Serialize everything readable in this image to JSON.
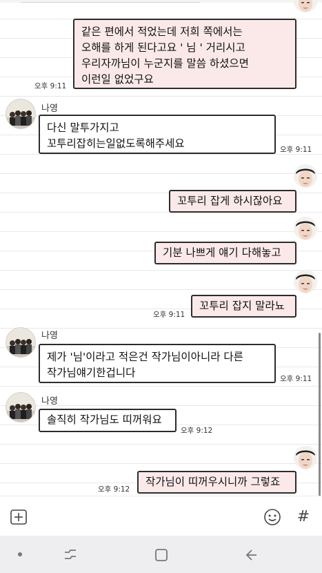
{
  "messages": [
    {
      "id": 1,
      "direction": "outgoing",
      "text": "같은 편에서 적었는데 저희 쪽에서는\n오해를 하게 된다고요 ' 님 ' 거리시고\n우리자까님이 누군지를 말씀 하셨으면\n이런일 없었구요",
      "time": "오후 9:11"
    },
    {
      "id": 2,
      "direction": "incoming",
      "sender": "나영",
      "text": "다신 말투가지고\n꼬투리잡히는일없도록해주세요",
      "time": "오후 9:11"
    },
    {
      "id": 3,
      "direction": "outgoing",
      "text": "꼬투리 잡게 하시잖아요"
    },
    {
      "id": 4,
      "direction": "outgoing",
      "text": "기분 나쁘게 얘기 다해놓고"
    },
    {
      "id": 5,
      "direction": "outgoing",
      "text": "꼬투리 잡지 말라뇨",
      "time": "오후 9:11"
    },
    {
      "id": 6,
      "direction": "incoming",
      "sender": "나영",
      "text": "제가 '님'이라고 적은건 작가님이아니라 다른\n작가님얘기한겁니다",
      "time": "오후 9:11"
    },
    {
      "id": 7,
      "direction": "incoming",
      "sender": "나영",
      "text": "솔직히 작가님도 띠꺼워요",
      "time": "오후 9:12"
    },
    {
      "id": 8,
      "direction": "outgoing",
      "text": "작가님이 띠꺼우시니까 그렇죠",
      "time": "오후 9:12"
    }
  ],
  "input_bar": {
    "icons": [
      "plus-icon",
      "emoji-icon",
      "hashtag-icon"
    ],
    "hashtag_glyph": "#"
  },
  "nav_bar": {
    "icons": [
      "dot-icon",
      "recent-apps-icon",
      "home-icon",
      "back-icon"
    ]
  },
  "colors": {
    "outgoing_bubble": "#fbe9e9",
    "incoming_bubble": "#ffffff",
    "bubble_border": "#2b2b2b",
    "nav_background": "#eeeef0"
  }
}
